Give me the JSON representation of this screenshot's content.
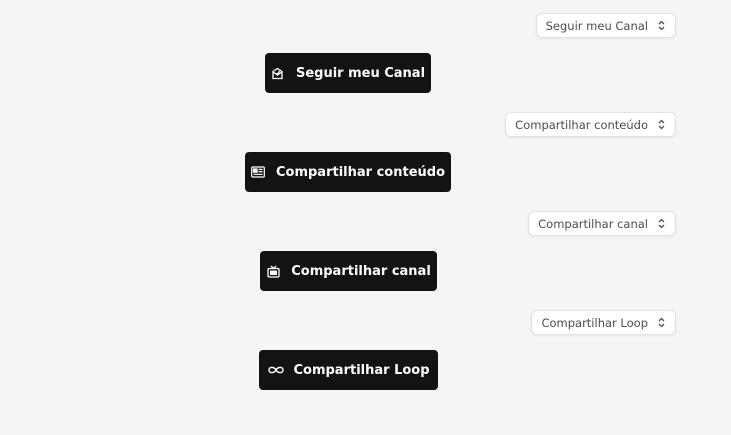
{
  "rows": [
    {
      "select_value": "Seguir meu Canal",
      "button_label": "Seguir meu Canal",
      "icon": "follow-icon"
    },
    {
      "select_value": "Compartilhar conteúdo",
      "button_label": "Compartilhar conteúdo",
      "icon": "newspaper-icon"
    },
    {
      "select_value": "Compartilhar canal",
      "button_label": "Compartilhar canal",
      "icon": "tv-icon"
    },
    {
      "select_value": "Compartilhar Loop",
      "button_label": "Compartilhar Loop",
      "icon": "infinity-icon"
    }
  ],
  "colors": {
    "background": "#f4f5f7",
    "button": "#131316",
    "button_text": "#ffffff",
    "select_text": "#4a4d52"
  }
}
